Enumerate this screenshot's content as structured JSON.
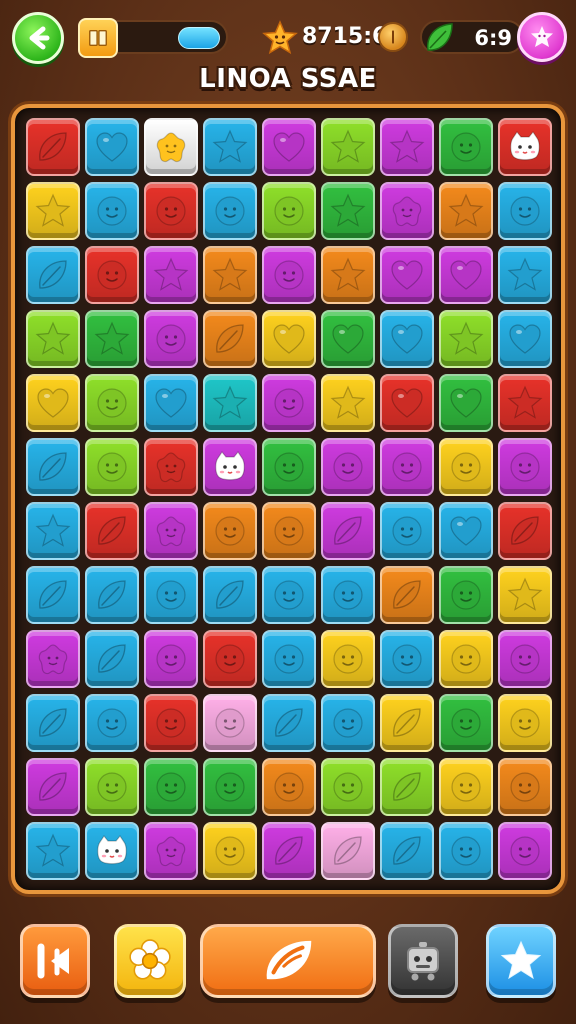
{
  "hud": {
    "score": "8715:6",
    "moves": "6:9",
    "progress_fraction": 0.28,
    "icons": {
      "back": "back-arrow-icon",
      "progress": "book-icon",
      "score": "star-face-icon",
      "coin": "coin-icon",
      "moves": "leaf-icon",
      "profile": "avatar-face-icon"
    }
  },
  "level_title": "LINOA SSAE",
  "colors": {
    "R": "#e8322a",
    "B": "#27b4ea",
    "W": "#ffffff",
    "P": "#cf3be0",
    "L": "#8fe02a",
    "G": "#32c040",
    "Y": "#ffd21e",
    "O": "#f48a1c",
    "K": "#ffb0e8",
    "M": "#b24ae8",
    "T": "#1fc7c9"
  },
  "board": {
    "rows": [
      [
        "R:leaf",
        "B:heart",
        "W:star-blob",
        "B:star",
        "P:heart",
        "L:star",
        "P:star",
        "G:face",
        "R:cat"
      ],
      [
        "Y:star",
        "B:face",
        "R:face",
        "B:face",
        "L:face",
        "G:star",
        "P:star-blob",
        "O:star",
        "B:face"
      ],
      [
        "B:leaf",
        "R:face",
        "P:star",
        "O:star",
        "P:face",
        "O:star",
        "P:heart",
        "P:heart",
        "B:star"
      ],
      [
        "L:star",
        "G:star",
        "P:face",
        "O:leaf",
        "Y:heart",
        "G:heart",
        "B:heart",
        "L:star",
        "B:heart"
      ],
      [
        "Y:heart",
        "L:face",
        "B:heart",
        "T:star",
        "P:face",
        "Y:star",
        "R:heart",
        "G:heart",
        "R:star"
      ],
      [
        "B:leaf",
        "L:face",
        "R:star-blob",
        "P:cat",
        "G:face",
        "P:face",
        "P:face",
        "Y:face",
        "P:face"
      ],
      [
        "B:star",
        "R:leaf",
        "P:star-blob",
        "O:face",
        "O:face",
        "P:leaf",
        "B:face",
        "B:heart",
        "R:leaf"
      ],
      [
        "B:leaf",
        "B:leaf",
        "B:face",
        "B:leaf",
        "B:face",
        "B:face",
        "O:leaf",
        "G:face",
        "Y:star"
      ],
      [
        "P:star-blob",
        "B:leaf",
        "P:face",
        "R:face",
        "B:face",
        "Y:face",
        "B:face",
        "Y:face",
        "P:face"
      ],
      [
        "B:leaf",
        "B:face",
        "R:face",
        "K:face",
        "B:leaf",
        "B:face",
        "Y:leaf",
        "G:face",
        "Y:face"
      ],
      [
        "P:leaf",
        "L:face",
        "G:face",
        "G:face",
        "O:face",
        "L:face",
        "L:leaf",
        "Y:face",
        "O:face"
      ],
      [
        "B:star",
        "B:cat",
        "P:star-blob",
        "Y:face",
        "P:leaf",
        "K:leaf",
        "B:leaf",
        "B:face",
        "P:face"
      ]
    ]
  },
  "bottom_bar": {
    "buttons": [
      {
        "name": "rewind-button",
        "icon": "rewind-icon"
      },
      {
        "name": "flower-booster-button",
        "icon": "flower-icon"
      },
      {
        "name": "shuffle-button",
        "icon": "leaf-swirl-icon"
      },
      {
        "name": "robot-button",
        "icon": "robot-icon"
      },
      {
        "name": "favorite-button",
        "icon": "star-icon"
      }
    ]
  }
}
